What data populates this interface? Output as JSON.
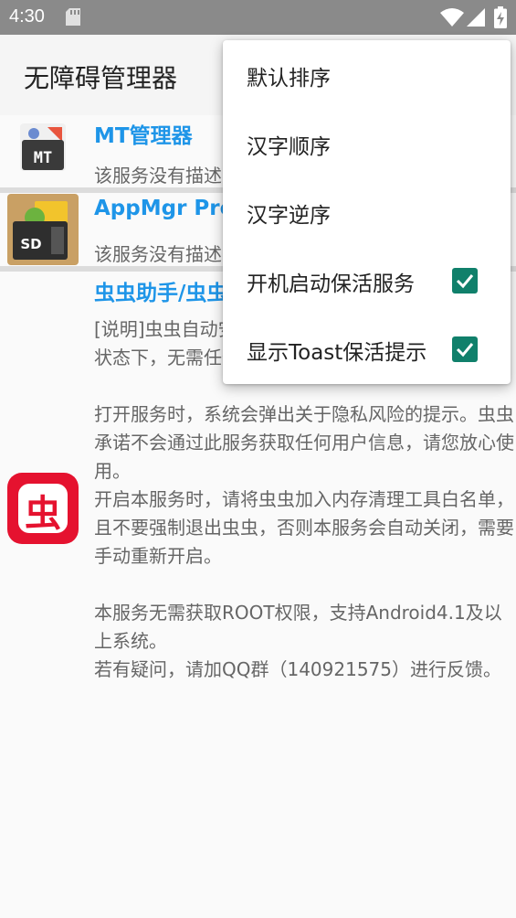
{
  "status_bar": {
    "time": "4:30",
    "icons": [
      "sd-card-icon",
      "wifi-icon",
      "signal-icon",
      "battery-charging-icon"
    ]
  },
  "app_bar": {
    "title": "无障碍管理器"
  },
  "list": {
    "items": [
      {
        "name": "MT管理器",
        "description": "该服务没有描述"
      },
      {
        "name": "AppMgr Pro III",
        "description": "该服务没有描述"
      },
      {
        "name": "虫虫助手/虫虫"
      }
    ],
    "long_description": [
      "[说明]虫虫自动安装服务，开启本服务后，在非锁屏状态下，无需任何操作也可安装应用。",
      "",
      "打开服务时，系统会弹出关于隐私风险的提示。虫虫承诺不会通过此服务获取任何用户信息，请您放心使用。",
      "开启本服务时，请将虫虫加入内存清理工具白名单，且不要强制退出虫虫，否则本服务会自动关闭，需要手动重新开启。",
      "",
      "本服务无需获取ROOT权限，支持Android4.1及以上系统。",
      "若有疑问，请加QQ群（140921575）进行反馈。"
    ]
  },
  "menu": {
    "items": [
      {
        "label": "默认排序"
      },
      {
        "label": "汉字顺序"
      },
      {
        "label": "汉字逆序"
      },
      {
        "label": "开机启动保活服务",
        "checked": true
      },
      {
        "label": "显示Toast保活提示",
        "checked": true
      }
    ]
  },
  "colors": {
    "accent": "#10806b",
    "link_blue": "#1e95e8",
    "status_bar": "#8a8a8a"
  }
}
